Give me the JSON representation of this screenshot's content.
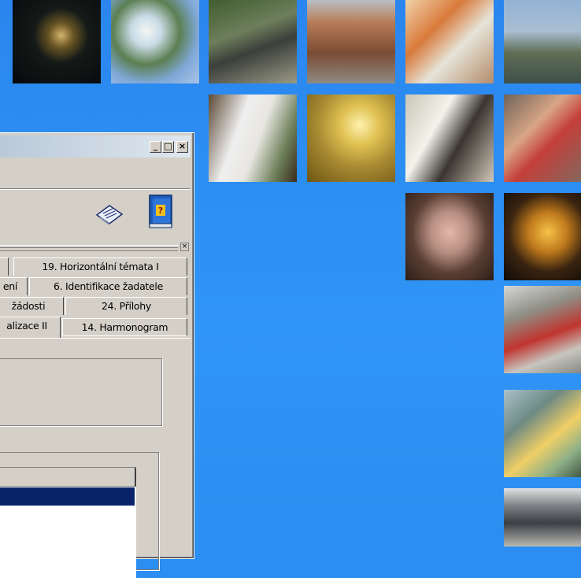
{
  "desktop": {
    "background_color": "#2b8ef0",
    "photo_tiles": [
      {
        "subject": "night-castle"
      },
      {
        "subject": "blossom-branch"
      },
      {
        "subject": "stroller-park"
      },
      {
        "subject": "building-facade"
      },
      {
        "subject": "students-computer"
      },
      {
        "subject": "city-skyline-river"
      },
      {
        "subject": "lab-scientist"
      },
      {
        "subject": "castle-sunset"
      },
      {
        "subject": "presentation-flipchart"
      },
      {
        "subject": "tourists-statue"
      },
      {
        "subject": "coins-stack"
      },
      {
        "subject": "gothic-tower-night"
      },
      {
        "subject": "construction-worker"
      },
      {
        "subject": "dentist-patient"
      },
      {
        "subject": "crowd-street"
      }
    ]
  },
  "window": {
    "controls": {
      "minimize": "_",
      "maximize": "□",
      "close": "×"
    },
    "toolbar_icons": [
      "notepad-icon",
      "help-book-icon"
    ],
    "panel_close": "×",
    "tabs": {
      "row1": [
        "19. Horizontální témata I"
      ],
      "row2": [
        "ení",
        "6. Identifikace žadatele"
      ],
      "row3": [
        "žádosti",
        "24. Přílohy"
      ],
      "row4": [
        "alizace II",
        "14. Harmonogram"
      ]
    },
    "list": {
      "selected_color": "#0a246a"
    }
  }
}
